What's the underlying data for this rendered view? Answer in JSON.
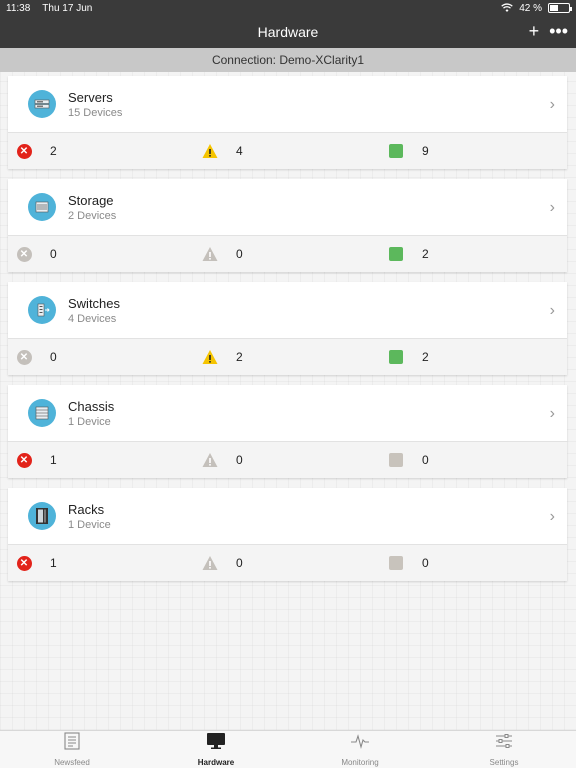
{
  "status_bar": {
    "time": "11:38",
    "date": "Thu 17 Jun",
    "battery": "42 %",
    "battery_level": 0.42
  },
  "nav": {
    "title": "Hardware"
  },
  "connection": {
    "text": "Connection: Demo-XClarity1"
  },
  "categories": [
    {
      "name": "Servers",
      "sub": "15 Devices",
      "icon": "server-icon",
      "critical": "2",
      "critical_active": true,
      "warning": "4",
      "warning_active": true,
      "normal": "9",
      "normal_active": true
    },
    {
      "name": "Storage",
      "sub": "2 Devices",
      "icon": "storage-icon",
      "critical": "0",
      "critical_active": false,
      "warning": "0",
      "warning_active": false,
      "normal": "2",
      "normal_active": true
    },
    {
      "name": "Switches",
      "sub": "4 Devices",
      "icon": "switch-icon",
      "critical": "0",
      "critical_active": false,
      "warning": "2",
      "warning_active": true,
      "normal": "2",
      "normal_active": true
    },
    {
      "name": "Chassis",
      "sub": "1 Device",
      "icon": "chassis-icon",
      "critical": "1",
      "critical_active": true,
      "warning": "0",
      "warning_active": false,
      "normal": "0",
      "normal_active": false
    },
    {
      "name": "Racks",
      "sub": "1 Device",
      "icon": "rack-icon",
      "critical": "1",
      "critical_active": true,
      "warning": "0",
      "warning_active": false,
      "normal": "0",
      "normal_active": false
    }
  ],
  "tabs": [
    {
      "label": "Newsfeed",
      "icon": "newsfeed-icon",
      "active": false
    },
    {
      "label": "Hardware",
      "icon": "monitor-icon",
      "active": true
    },
    {
      "label": "Monitoring",
      "icon": "pulse-icon",
      "active": false
    },
    {
      "label": "Settings",
      "icon": "sliders-icon",
      "active": false
    }
  ],
  "colors": {
    "critical": "#e2231a",
    "warning": "#f5c400",
    "normal": "#5cb85c",
    "inactive": "#c4c0bb",
    "accent": "#4fb3d9",
    "header": "#3a3a3a"
  }
}
